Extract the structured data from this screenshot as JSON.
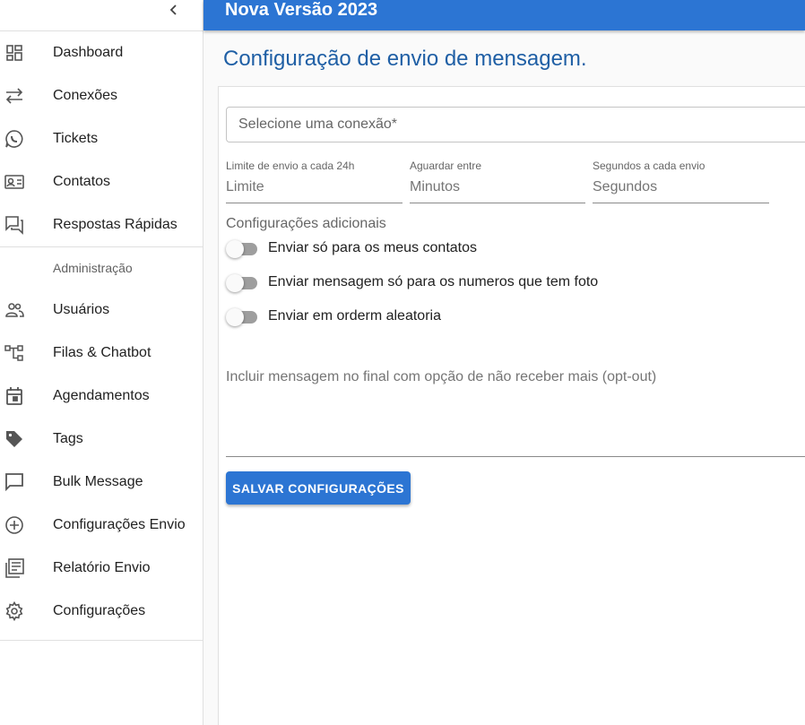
{
  "app": {
    "title": "Nova Versão 2023"
  },
  "sidebar": {
    "items": [
      {
        "label": "Dashboard",
        "icon": "dashboard-icon"
      },
      {
        "label": "Conexões",
        "icon": "sync-arrows-icon"
      },
      {
        "label": "Tickets",
        "icon": "whatsapp-icon"
      },
      {
        "label": "Contatos",
        "icon": "contact-card-icon"
      },
      {
        "label": "Respostas Rápidas",
        "icon": "quick-reply-icon"
      }
    ],
    "admin_header": "Administração",
    "admin_items": [
      {
        "label": "Usuários",
        "icon": "people-icon"
      },
      {
        "label": "Filas & Chatbot",
        "icon": "tree-icon"
      },
      {
        "label": "Agendamentos",
        "icon": "calendar-icon"
      },
      {
        "label": "Tags",
        "icon": "tag-icon"
      },
      {
        "label": "Bulk Message",
        "icon": "chat-bubble-icon"
      },
      {
        "label": "Configurações Envio",
        "icon": "add-circle-icon"
      },
      {
        "label": "Relatório Envio",
        "icon": "report-icon"
      },
      {
        "label": "Configurações",
        "icon": "gear-icon"
      }
    ]
  },
  "main": {
    "page_title": "Configuração de envio de mensagem.",
    "connection_select": {
      "placeholder": "Selecione uma conexão*"
    },
    "fields": [
      {
        "label": "Limite de envio a cada 24h",
        "placeholder": "Limite"
      },
      {
        "label": "Aguardar entre",
        "placeholder": "Minutos"
      },
      {
        "label": "Segundos a cada envio",
        "placeholder": "Segundos"
      }
    ],
    "additional_label": "Configurações adicionais",
    "switches": [
      {
        "label": "Enviar só para os meus contatos",
        "checked": false
      },
      {
        "label": "Enviar mensagem só para os numeros que tem foto",
        "checked": false
      },
      {
        "label": "Enviar em orderm aleatoria",
        "checked": false
      }
    ],
    "optout_placeholder": "Incluir mensagem no final com opção de não receber mais (opt-out)",
    "save_label": "SALVAR CONFIGURAÇÕES"
  },
  "colors": {
    "primary": "#2c75d3",
    "title": "#1f5fa5",
    "switch_off": "#9e9e9e"
  }
}
